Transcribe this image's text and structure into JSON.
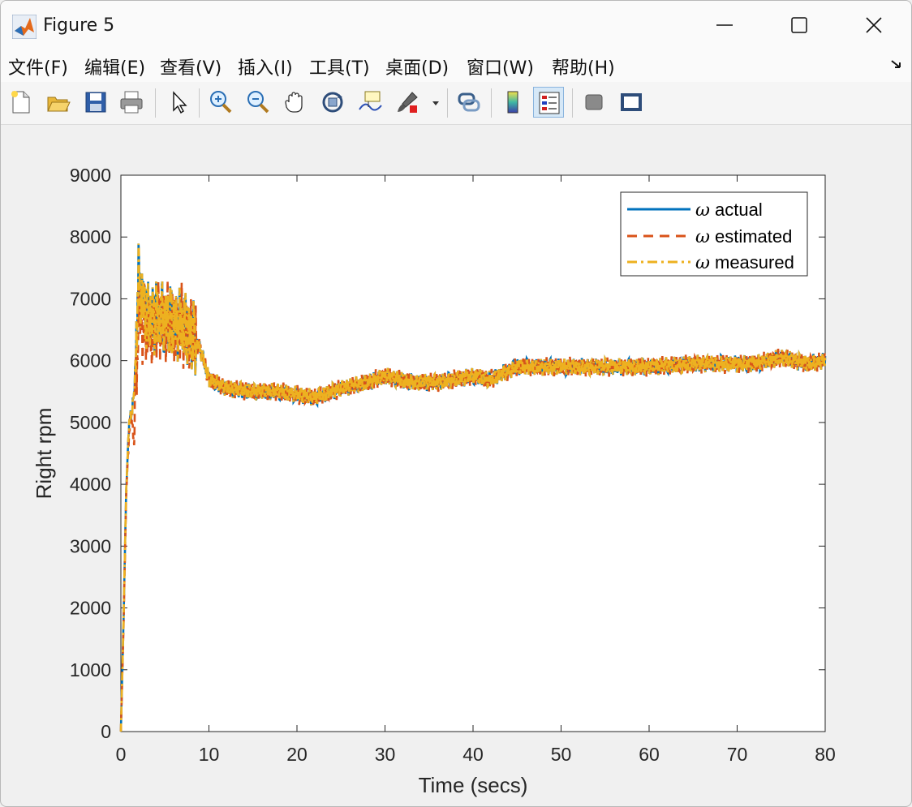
{
  "window": {
    "title": "Figure 5"
  },
  "menu": {
    "items": [
      "文件(F)",
      "编辑(E)",
      "查看(V)",
      "插入(I)",
      "工具(T)",
      "桌面(D)",
      "窗口(W)",
      "帮助(H)"
    ]
  },
  "toolbar": {
    "icons": [
      "new-figure-icon",
      "open-file-icon",
      "save-icon",
      "print-icon",
      "edit-plot-cursor-icon",
      "zoom-in-icon",
      "zoom-out-icon",
      "pan-hand-icon",
      "rotate-3d-icon",
      "data-cursor-icon",
      "brush-icon",
      "brush-dropdown-icon",
      "link-plot-icon",
      "insert-colorbar-icon",
      "insert-legend-icon",
      "hide-plot-tools-icon",
      "show-plot-tools-icon"
    ]
  },
  "colors": {
    "actual": "#0072BD",
    "estimated": "#D95319",
    "measured": "#EDB120"
  },
  "chart_data": {
    "type": "line",
    "xlabel": "Time (secs)",
    "ylabel": "Right rpm",
    "xlim": [
      0,
      80
    ],
    "ylim": [
      0,
      9000
    ],
    "xticks": [
      "0",
      "10",
      "20",
      "30",
      "40",
      "50",
      "60",
      "70",
      "80"
    ],
    "yticks": [
      "0",
      "1000",
      "2000",
      "3000",
      "4000",
      "5000",
      "6000",
      "7000",
      "8000",
      "9000"
    ],
    "grid": false,
    "legend_position": "top-right",
    "legend_symbol": "ω",
    "series": [
      {
        "name": "actual",
        "style": "solid",
        "x": [
          0,
          0.3,
          0.6,
          0.9,
          1.2,
          1.5,
          2,
          2.5,
          3,
          4,
          5,
          6,
          7,
          8,
          9,
          10,
          12,
          15,
          18,
          20,
          22,
          25,
          28,
          30,
          33,
          36,
          40,
          42,
          45,
          50,
          55,
          60,
          65,
          70,
          72,
          75,
          78,
          80
        ],
        "y": [
          0,
          1800,
          3900,
          4900,
          5200,
          5400,
          7300,
          6900,
          6700,
          6700,
          6700,
          6600,
          6600,
          6400,
          6200,
          5700,
          5550,
          5500,
          5500,
          5450,
          5400,
          5550,
          5650,
          5750,
          5650,
          5650,
          5750,
          5700,
          5900,
          5900,
          5900,
          5900,
          5950,
          5950,
          5950,
          6050,
          5950,
          6000
        ]
      },
      {
        "name": "estimated",
        "style": "dashed",
        "x": [
          0,
          0.3,
          0.6,
          0.9,
          1.2,
          1.5,
          2,
          2.5,
          3,
          4,
          5,
          6,
          7,
          8,
          9,
          10,
          12,
          15,
          18,
          20,
          22,
          25,
          28,
          30,
          33,
          36,
          40,
          42,
          45,
          50,
          55,
          60,
          65,
          70,
          72,
          75,
          78,
          80
        ],
        "y": [
          0,
          1700,
          3800,
          4800,
          5100,
          4700,
          6800,
          6600,
          6500,
          6600,
          6650,
          6550,
          6550,
          6400,
          6200,
          5700,
          5550,
          5500,
          5500,
          5450,
          5400,
          5550,
          5650,
          5750,
          5650,
          5650,
          5750,
          5700,
          5900,
          5900,
          5900,
          5900,
          5950,
          5950,
          5950,
          6050,
          5950,
          6000
        ]
      },
      {
        "name": "measured",
        "style": "dashdot",
        "x": [
          0,
          0.3,
          0.6,
          0.9,
          1.2,
          1.5,
          2,
          2.5,
          3,
          4,
          5,
          6,
          7,
          8,
          9,
          10,
          12,
          15,
          18,
          20,
          22,
          25,
          28,
          30,
          33,
          36,
          40,
          42,
          45,
          50,
          55,
          60,
          65,
          70,
          72,
          75,
          78,
          80
        ],
        "y": [
          0,
          1800,
          3900,
          4900,
          5200,
          5400,
          7300,
          6900,
          6700,
          6700,
          6700,
          6600,
          6600,
          6400,
          6200,
          5700,
          5550,
          5500,
          5500,
          5450,
          5400,
          5550,
          5650,
          5750,
          5650,
          5650,
          5750,
          5700,
          5900,
          5900,
          5900,
          5900,
          5950,
          5950,
          5950,
          6050,
          5950,
          6000
        ]
      }
    ]
  }
}
